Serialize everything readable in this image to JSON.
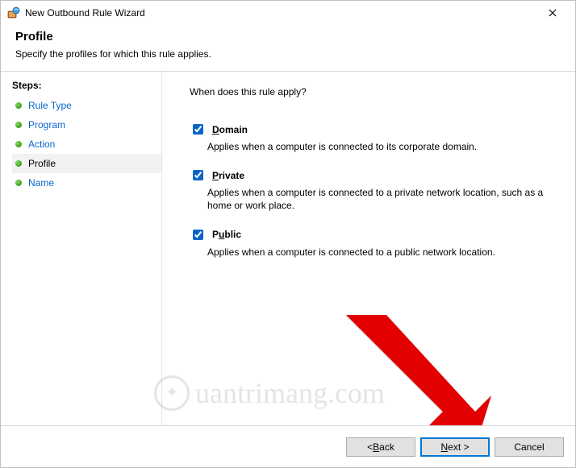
{
  "window": {
    "title": "New Outbound Rule Wizard"
  },
  "header": {
    "title": "Profile",
    "subtitle": "Specify the profiles for which this rule applies."
  },
  "sidebar": {
    "label": "Steps:",
    "items": [
      {
        "label": "Rule Type",
        "selected": false
      },
      {
        "label": "Program",
        "selected": false
      },
      {
        "label": "Action",
        "selected": false
      },
      {
        "label": "Profile",
        "selected": true
      },
      {
        "label": "Name",
        "selected": false
      }
    ]
  },
  "content": {
    "question": "When does this rule apply?",
    "options": [
      {
        "accel": "D",
        "rest": "omain",
        "checked": true,
        "desc": "Applies when a computer is connected to its corporate domain."
      },
      {
        "accel": "P",
        "rest": "rivate",
        "checked": true,
        "desc": "Applies when a computer is connected to a private network location, such as a home or work place."
      },
      {
        "accel": "P",
        "rest": "ublic",
        "blank": "u",
        "checked": true,
        "desc": "Applies when a computer is connected to a public network location."
      }
    ]
  },
  "buttons": {
    "back_prefix": "< ",
    "back_accel": "B",
    "back_rest": "ack",
    "next_accel": "N",
    "next_rest": "ext >",
    "cancel": "Cancel"
  },
  "watermark": "uantrimang.com"
}
